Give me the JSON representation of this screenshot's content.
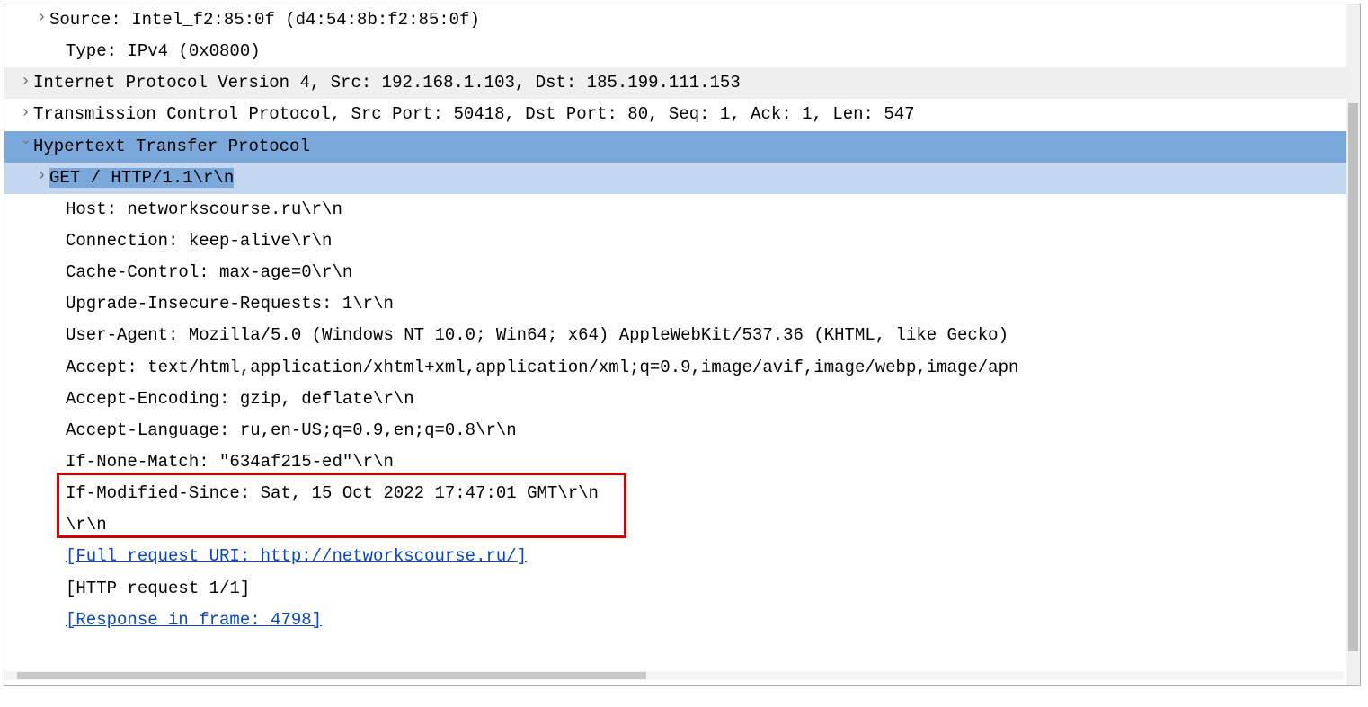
{
  "packet": {
    "ethernet": {
      "source": "Source: Intel_f2:85:0f (d4:54:8b:f2:85:0f)",
      "type": "Type: IPv4 (0x0800)"
    },
    "ip": "Internet Protocol Version 4, Src: 192.168.1.103, Dst: 185.199.111.153",
    "tcp": "Transmission Control Protocol, Src Port: 50418, Dst Port: 80, Seq: 1, Ack: 1, Len: 547",
    "http": {
      "title": "Hypertext Transfer Protocol",
      "request_line": "GET / HTTP/1.1\\r\\n",
      "headers": {
        "host": "Host: networkscourse.ru\\r\\n",
        "connection": "Connection: keep-alive\\r\\n",
        "cache_control": "Cache-Control: max-age=0\\r\\n",
        "upgrade_insecure": "Upgrade-Insecure-Requests: 1\\r\\n",
        "user_agent": "User-Agent: Mozilla/5.0 (Windows NT 10.0; Win64; x64) AppleWebKit/537.36 (KHTML, like Gecko) ",
        "accept": "Accept: text/html,application/xhtml+xml,application/xml;q=0.9,image/avif,image/webp,image/apn",
        "accept_encoding": "Accept-Encoding: gzip, deflate\\r\\n",
        "accept_language": "Accept-Language: ru,en-US;q=0.9,en;q=0.8\\r\\n",
        "if_none_match": "If-None-Match: \"634af215-ed\"\\r\\n",
        "if_modified_since": "If-Modified-Since: Sat, 15 Oct 2022 17:47:01 GMT\\r\\n",
        "blank": "\\r\\n"
      },
      "full_uri": "[Full request URI: http://networkscourse.ru/]",
      "request_num": "[HTTP request 1/1]",
      "response_frame": "[Response in frame: 4798]"
    }
  }
}
